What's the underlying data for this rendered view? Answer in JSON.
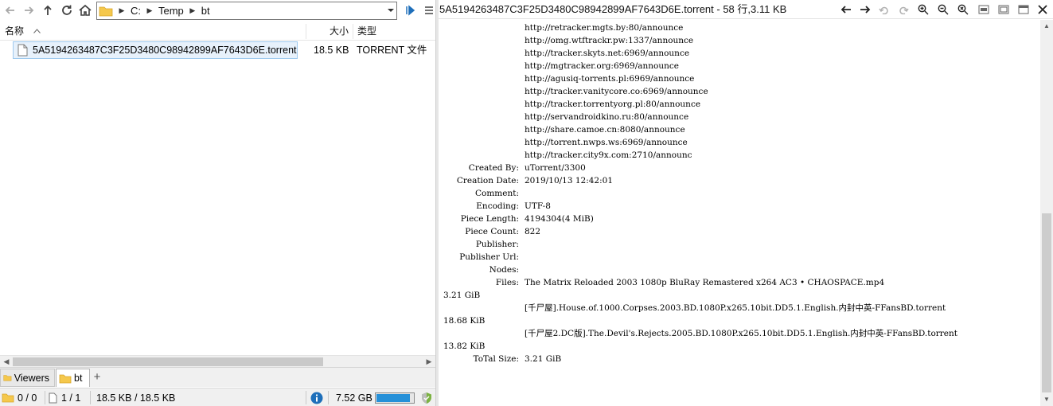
{
  "nav": {
    "back_icon": "arrow-left-icon",
    "forward_icon": "arrow-right-icon",
    "up_icon": "arrow-up-icon",
    "refresh_icon": "refresh-icon",
    "home_icon": "home-icon",
    "breadcrumb": [
      "C:",
      "Temp",
      "bt"
    ]
  },
  "columns": {
    "name": "名称",
    "size": "大小",
    "type": "类型"
  },
  "files": [
    {
      "name": "5A5194263487C3F25D3480C98942899AF7643D6E.torrent",
      "size": "18.5 KB",
      "type": "TORRENT 文件"
    }
  ],
  "tabs": [
    {
      "label": "Viewers"
    },
    {
      "label": "bt"
    }
  ],
  "add_tab": "+",
  "status": {
    "selected_folders": "0 / 0",
    "selected_files": "1 / 1",
    "selected_size": "18.5 KB / 18.5 KB",
    "free_space": "7.52 GB",
    "free_fraction": 0.92
  },
  "viewer": {
    "title": "5A5194263487C3F25D3480C98942899AF7643D6E.torrent - 58 行,3.11 KB",
    "lines": [
      {
        "k": "",
        "v": "http://retracker.mgts.by:80/announce"
      },
      {
        "k": "",
        "v": "http://omg.wtftrackr.pw:1337/announce"
      },
      {
        "k": "",
        "v": "http://tracker.skyts.net:6969/announce"
      },
      {
        "k": "",
        "v": "http://mgtracker.org:6969/announce"
      },
      {
        "k": "",
        "v": "http://agusiq-torrents.pl:6969/announce"
      },
      {
        "k": "",
        "v": "http://tracker.vanitycore.co:6969/announce"
      },
      {
        "k": "",
        "v": "http://tracker.torrentyorg.pl:80/announce"
      },
      {
        "k": "",
        "v": "http://servandroidkino.ru:80/announce"
      },
      {
        "k": "",
        "v": "http://share.camoe.cn:8080/announce"
      },
      {
        "k": "",
        "v": "http://torrent.nwps.ws:6969/announce"
      },
      {
        "k": "",
        "v": "http://tracker.city9x.com:2710/announc"
      },
      {
        "k": "Created By:",
        "v": "uTorrent/3300"
      },
      {
        "k": "Creation Date:",
        "v": "2019/10/13 12:42:01"
      },
      {
        "k": "Comment:",
        "v": ""
      },
      {
        "k": "Encoding:",
        "v": "UTF-8"
      },
      {
        "k": "Piece Length:",
        "v": "4194304(4 MiB)"
      },
      {
        "k": "Piece Count:",
        "v": "822"
      },
      {
        "k": "Publisher:",
        "v": ""
      },
      {
        "k": "Publisher Url:",
        "v": ""
      },
      {
        "k": "Nodes:",
        "v": ""
      },
      {
        "k": "Files:",
        "v": "The Matrix Reloaded 2003 1080p BluRay Remastered x264 AC3 • CHAOSPACE.mp4"
      },
      {
        "k": "",
        "v": "",
        "raw": "3.21 GiB"
      },
      {
        "k": "",
        "v": "[千尸屋].House.of.1000.Corpses.2003.BD.1080P.x265.10bit.DD5.1.English.内封中英-FFansBD.torrent"
      },
      {
        "k": "",
        "v": "",
        "raw": "18.68 KiB"
      },
      {
        "k": "",
        "v": "[千尸屋2.DC版].The.Devil's.Rejects.2005.BD.1080P.x265.10bit.DD5.1.English.内封中英-FFansBD.torrent"
      },
      {
        "k": "",
        "v": "",
        "raw": "13.82 KiB"
      },
      {
        "k": "ToTal Size:",
        "v": "3.21 GiB"
      }
    ]
  }
}
